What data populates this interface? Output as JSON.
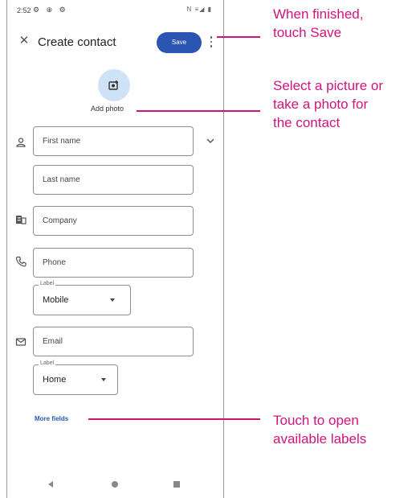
{
  "status_bar": {
    "time": "2:52",
    "left_icons": "⚙ ⊕ ⚙",
    "right_icons": "N ≡◢ ▮"
  },
  "app_bar": {
    "title": "Create contact",
    "save_label": "Save"
  },
  "photo": {
    "add_photo_label": "Add photo"
  },
  "fields": {
    "first_name_placeholder": "First name",
    "last_name_placeholder": "Last name",
    "company_placeholder": "Company",
    "phone_placeholder": "Phone",
    "email_placeholder": "Email"
  },
  "phone_label": {
    "legend": "Label",
    "value": "Mobile"
  },
  "email_label": {
    "legend": "Label",
    "value": "Home"
  },
  "more_fields_label": "More fields",
  "callouts": {
    "save": [
      "When finished,",
      "touch Save"
    ],
    "photo": [
      "Select a picture or",
      "take a photo for",
      "the contact"
    ],
    "more_fields": [
      "Touch to open",
      "available labels"
    ]
  },
  "colors": {
    "accent": "#2b55b3",
    "callout": "#d1147d",
    "photo_circle": "#cfe3f7"
  }
}
